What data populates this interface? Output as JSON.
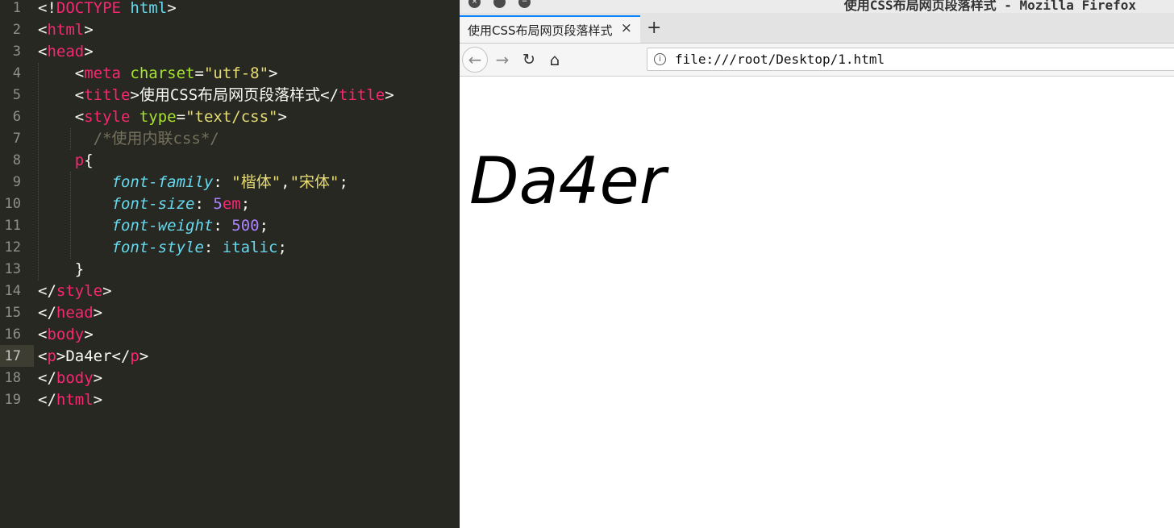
{
  "editor": {
    "lines": [
      {
        "num": "1",
        "tokens": [
          {
            "c": "p",
            "t": "<!"
          },
          {
            "c": "t",
            "t": "DOCTYPE"
          },
          {
            "c": "p",
            "t": " "
          },
          {
            "c": "kw",
            "t": "html"
          },
          {
            "c": "p",
            "t": ">"
          }
        ]
      },
      {
        "num": "2",
        "tokens": [
          {
            "c": "p",
            "t": "<"
          },
          {
            "c": "t",
            "t": "html"
          },
          {
            "c": "p",
            "t": ">"
          }
        ]
      },
      {
        "num": "3",
        "tokens": [
          {
            "c": "p",
            "t": "<"
          },
          {
            "c": "t",
            "t": "head"
          },
          {
            "c": "p",
            "t": ">"
          }
        ]
      },
      {
        "num": "4",
        "tokens": [
          {
            "c": "p",
            "t": "    <"
          },
          {
            "c": "t",
            "t": "meta"
          },
          {
            "c": "p",
            "t": " "
          },
          {
            "c": "a",
            "t": "charset"
          },
          {
            "c": "p",
            "t": "="
          },
          {
            "c": "s",
            "t": "\"utf-8\""
          },
          {
            "c": "p",
            "t": ">"
          }
        ]
      },
      {
        "num": "5",
        "tokens": [
          {
            "c": "p",
            "t": "    <"
          },
          {
            "c": "t",
            "t": "title"
          },
          {
            "c": "p",
            "t": ">使用CSS布局网页段落样式</"
          },
          {
            "c": "t",
            "t": "title"
          },
          {
            "c": "p",
            "t": ">"
          }
        ]
      },
      {
        "num": "6",
        "tokens": [
          {
            "c": "p",
            "t": "    <"
          },
          {
            "c": "t",
            "t": "style"
          },
          {
            "c": "p",
            "t": " "
          },
          {
            "c": "a",
            "t": "type"
          },
          {
            "c": "p",
            "t": "="
          },
          {
            "c": "s",
            "t": "\"text/css\""
          },
          {
            "c": "p",
            "t": ">"
          }
        ]
      },
      {
        "num": "7",
        "tokens": [
          {
            "c": "p",
            "t": "      "
          },
          {
            "c": "c",
            "t": "/*使用内联css*/"
          }
        ]
      },
      {
        "num": "8",
        "tokens": [
          {
            "c": "p",
            "t": "    "
          },
          {
            "c": "t",
            "t": "p"
          },
          {
            "c": "p",
            "t": "{"
          }
        ]
      },
      {
        "num": "9",
        "tokens": [
          {
            "c": "p",
            "t": "        "
          },
          {
            "c": "pr",
            "t": "font-family"
          },
          {
            "c": "p",
            "t": ": "
          },
          {
            "c": "s",
            "t": "\"楷体\""
          },
          {
            "c": "p",
            "t": ","
          },
          {
            "c": "s",
            "t": "\"宋体\""
          },
          {
            "c": "p",
            "t": ";"
          }
        ]
      },
      {
        "num": "10",
        "tokens": [
          {
            "c": "p",
            "t": "        "
          },
          {
            "c": "pr",
            "t": "font-size"
          },
          {
            "c": "p",
            "t": ": "
          },
          {
            "c": "n",
            "t": "5"
          },
          {
            "c": "t",
            "t": "em"
          },
          {
            "c": "p",
            "t": ";"
          }
        ]
      },
      {
        "num": "11",
        "tokens": [
          {
            "c": "p",
            "t": "        "
          },
          {
            "c": "pr",
            "t": "font-weight"
          },
          {
            "c": "p",
            "t": ": "
          },
          {
            "c": "n",
            "t": "500"
          },
          {
            "c": "p",
            "t": ";"
          }
        ]
      },
      {
        "num": "12",
        "tokens": [
          {
            "c": "p",
            "t": "        "
          },
          {
            "c": "pr",
            "t": "font-style"
          },
          {
            "c": "p",
            "t": ": "
          },
          {
            "c": "kw",
            "t": "italic"
          },
          {
            "c": "p",
            "t": ";"
          }
        ]
      },
      {
        "num": "13",
        "tokens": [
          {
            "c": "p",
            "t": "    }"
          }
        ]
      },
      {
        "num": "14",
        "tokens": [
          {
            "c": "p",
            "t": "</"
          },
          {
            "c": "t",
            "t": "style"
          },
          {
            "c": "p",
            "t": ">"
          }
        ]
      },
      {
        "num": "15",
        "tokens": [
          {
            "c": "p",
            "t": "</"
          },
          {
            "c": "t",
            "t": "head"
          },
          {
            "c": "p",
            "t": ">"
          }
        ]
      },
      {
        "num": "16",
        "tokens": [
          {
            "c": "p",
            "t": "<"
          },
          {
            "c": "t",
            "t": "body"
          },
          {
            "c": "p",
            "t": ">"
          }
        ]
      },
      {
        "num": "17",
        "tokens": [
          {
            "c": "p",
            "t": "<"
          },
          {
            "c": "t",
            "t": "p"
          },
          {
            "c": "p",
            "t": ">Da4er</"
          },
          {
            "c": "t",
            "t": "p"
          },
          {
            "c": "p",
            "t": ">"
          }
        ]
      },
      {
        "num": "18",
        "tokens": [
          {
            "c": "p",
            "t": "</"
          },
          {
            "c": "t",
            "t": "body"
          },
          {
            "c": "p",
            "t": ">"
          }
        ]
      },
      {
        "num": "19",
        "tokens": [
          {
            "c": "p",
            "t": "</"
          },
          {
            "c": "t",
            "t": "html"
          },
          {
            "c": "p",
            "t": ">"
          }
        ]
      }
    ],
    "active_line": "17"
  },
  "browser": {
    "window_title": "使用CSS布局网页段落样式 - Mozilla Firefox",
    "close_icon": "×",
    "minimize_icon": "−",
    "tab_title": "使用CSS布局网页段落样式",
    "tab_close": "×",
    "new_tab": "+",
    "back_icon": "←",
    "forward_icon": "→",
    "reload_icon": "↻",
    "home_icon": "⌂",
    "info_icon": "i",
    "url": "file:///root/Desktop/1.html",
    "page_text": "Da4er"
  }
}
